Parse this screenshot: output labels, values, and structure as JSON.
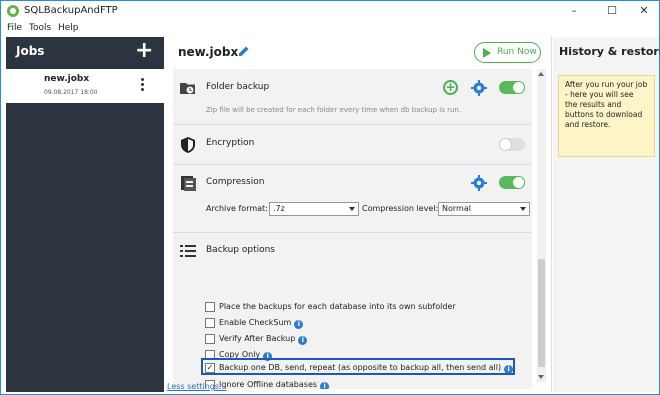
{
  "window": {
    "title": "SQLBackupAndFTP",
    "controls": [
      "–",
      "☐",
      "✕"
    ]
  },
  "menu": [
    "File",
    "Tools",
    "Help"
  ],
  "sidebar": {
    "title": "Jobs",
    "add_label": "+",
    "jobs": [
      {
        "name": "new.jobx",
        "date": "09.08.2017 18:00"
      }
    ]
  },
  "main": {
    "job_title": "new.jobx",
    "run_label": "Run Now",
    "sections": {
      "folder": {
        "title": "Folder backup",
        "subtitle": "Zip file will be created for each folder every time when db backup is run.",
        "enabled": true
      },
      "encryption": {
        "title": "Encryption",
        "enabled": false
      },
      "compression": {
        "title": "Compression",
        "enabled": true,
        "archive_label": "Archive format:",
        "archive_value": ".7z",
        "level_label": "Compression level:",
        "level_value": "Normal"
      },
      "backup_options": {
        "title": "Backup options",
        "options": [
          {
            "label": "Place the backups for each database into its own subfolder",
            "checked": false,
            "info": false
          },
          {
            "label": "Enable CheckSum",
            "checked": false,
            "info": true
          },
          {
            "label": "Verify After Backup",
            "checked": false,
            "info": true
          },
          {
            "label": "Copy Only",
            "checked": false,
            "info": true
          },
          {
            "label": "Backup one DB, send, repeat (as opposite to backup all, then send all)",
            "checked": true,
            "info": true
          },
          {
            "label": "Ignore Offline databases",
            "checked": false,
            "info": true
          }
        ]
      }
    },
    "less_settings": "Less settings..."
  },
  "history": {
    "title": "History & restore",
    "note": "After you run your job - here you will see the results and buttons to download and restore."
  },
  "colors": {
    "accent_green": "#4caf50",
    "sidebar_bg": "#2c3440",
    "info_blue": "#2a7dcf",
    "highlight": "#1f57b8"
  }
}
